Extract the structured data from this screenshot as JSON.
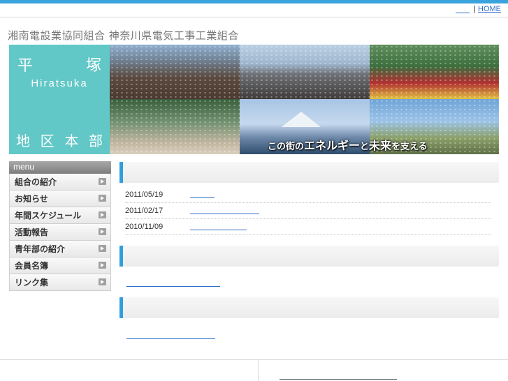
{
  "header": {
    "home_link": "HOME",
    "separator": "|",
    "org_names": "湘南電設業協同組合 神奈川県電気工事工業組合"
  },
  "hero": {
    "kanji_top": [
      "平",
      "塚"
    ],
    "roman": "Hiratsuka",
    "kanji_bottom": [
      "地",
      "区",
      "本",
      "部"
    ],
    "slogan_a": "この街の",
    "slogan_b": "エネルギー",
    "slogan_c": "と",
    "slogan_d": "未来",
    "slogan_e": "を支える"
  },
  "menu": {
    "heading": "menu",
    "items": [
      {
        "label": "組合の紹介"
      },
      {
        "label": "お知らせ"
      },
      {
        "label": "年間スケジュール"
      },
      {
        "label": "活動報告"
      },
      {
        "label": "青年部の紹介"
      },
      {
        "label": "会員名簿"
      },
      {
        "label": "リンク集"
      }
    ]
  },
  "news": [
    {
      "date": "2011/05/19"
    },
    {
      "date": "2011/02/17"
    },
    {
      "date": "2010/11/09"
    }
  ],
  "colors": {
    "accent": "#2f9fdc",
    "teal": "#62c7c7",
    "link": "#2f6fc9"
  }
}
